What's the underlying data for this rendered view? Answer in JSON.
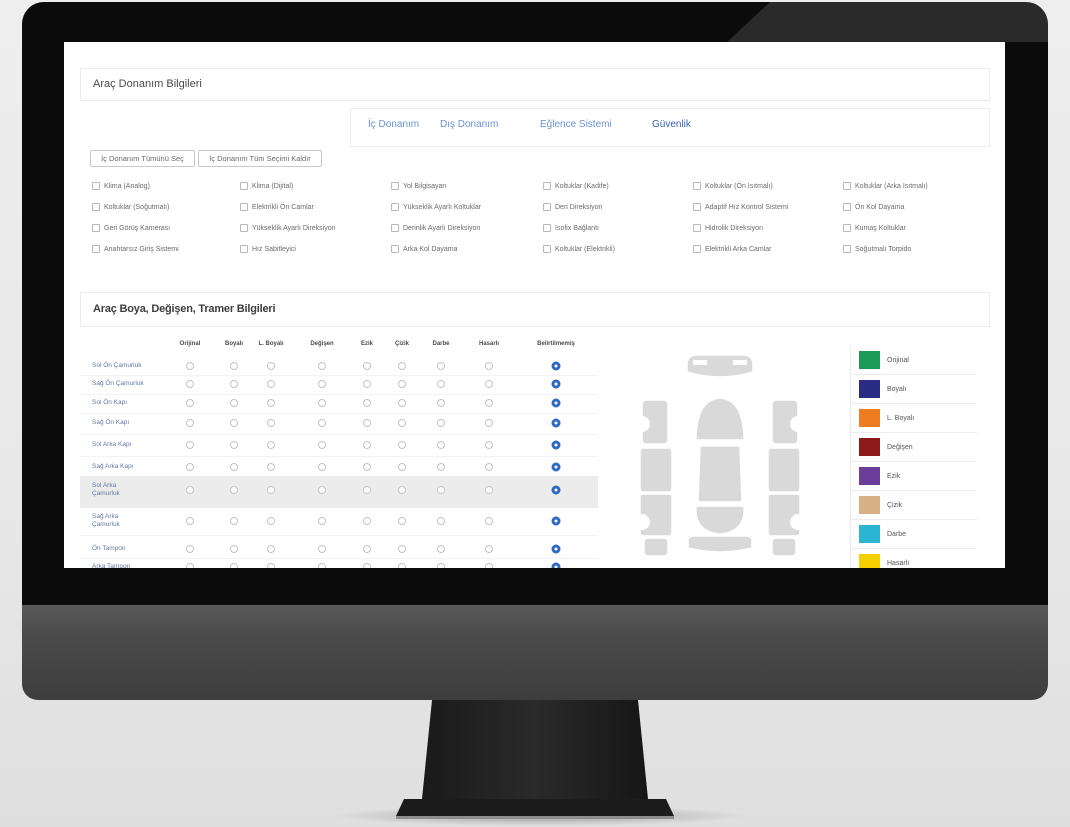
{
  "equipment": {
    "title": "Araç Donanım Bilgileri",
    "tabs": [
      {
        "label": "İç Donanım",
        "active": false
      },
      {
        "label": "Dış Donanım",
        "active": false
      },
      {
        "label": "Eğlence Sistemi",
        "active": false
      },
      {
        "label": "Güvenlik",
        "active": true
      }
    ],
    "select_all_label": "İç Donanım Tümünü Seç",
    "clear_all_label": "İç Donanım Tüm Seçimi Kaldır",
    "options": [
      [
        "Klima (Analog)",
        "Klima (Dijital)",
        "Yol Bilgisayarı",
        "Koltuklar (Kadife)",
        "Koltuklar (Ön Isıtmalı)",
        "Koltuklar (Arka Isıtmalı)"
      ],
      [
        "Koltuklar (Soğutmalı)",
        "Elektrikli Ön Camlar",
        "Yükseklik Ayarlı Koltuklar",
        "Deri Direksiyon",
        "Adaptif Hız Kontrol Sistemi",
        "Ön Kol Dayama"
      ],
      [
        "Geri Görüş Kamerası",
        "Yükseklik Ayarlı Direksiyon",
        "Derinlik Ayarlı Direksiyon",
        "Isofix Bağlantı",
        "Hidrolik Direksiyon",
        "Kumaş Koltuklar"
      ],
      [
        "Anahtarsız Giriş Sistemi",
        "Hız Sabitleyici",
        "Arka Kol Dayama",
        "Koltuklar (Elektrikli)",
        "Elektrikli Arka Camlar",
        "Soğutmalı Torpido"
      ]
    ]
  },
  "damage": {
    "title": "Araç Boya, Değişen, Tramer Bilgileri",
    "statuses": [
      {
        "label": "Orijinal",
        "color": "#1d9a55"
      },
      {
        "label": "Boyalı",
        "color": "#2a2c84"
      },
      {
        "label": "L. Boyalı",
        "color": "#ef7c21"
      },
      {
        "label": "Değişen",
        "color": "#8e1b1b"
      },
      {
        "label": "Ezik",
        "color": "#6a3d9a"
      },
      {
        "label": "Çizik",
        "color": "#d7b185"
      },
      {
        "label": "Darbe",
        "color": "#2bb5d3"
      },
      {
        "label": "Hasarlı",
        "color": "#f6d000"
      }
    ],
    "unspecified_label": "Belirtilmemiş",
    "selected_status": "Belirtilmemiş",
    "parts": [
      "Sol Ön Çamurluk",
      "Sağ Ön Çamurluk",
      "Sol Ön Kapı",
      "Sağ Ön Kapı",
      "Sol Arka Kapı",
      "Sağ Arka Kapı",
      "Sol Arka Çamurluk",
      "Sağ Arka Çamurluk",
      "Ön Tampon",
      "Arka Tampon"
    ],
    "accent_color": "#2c6bc2"
  }
}
